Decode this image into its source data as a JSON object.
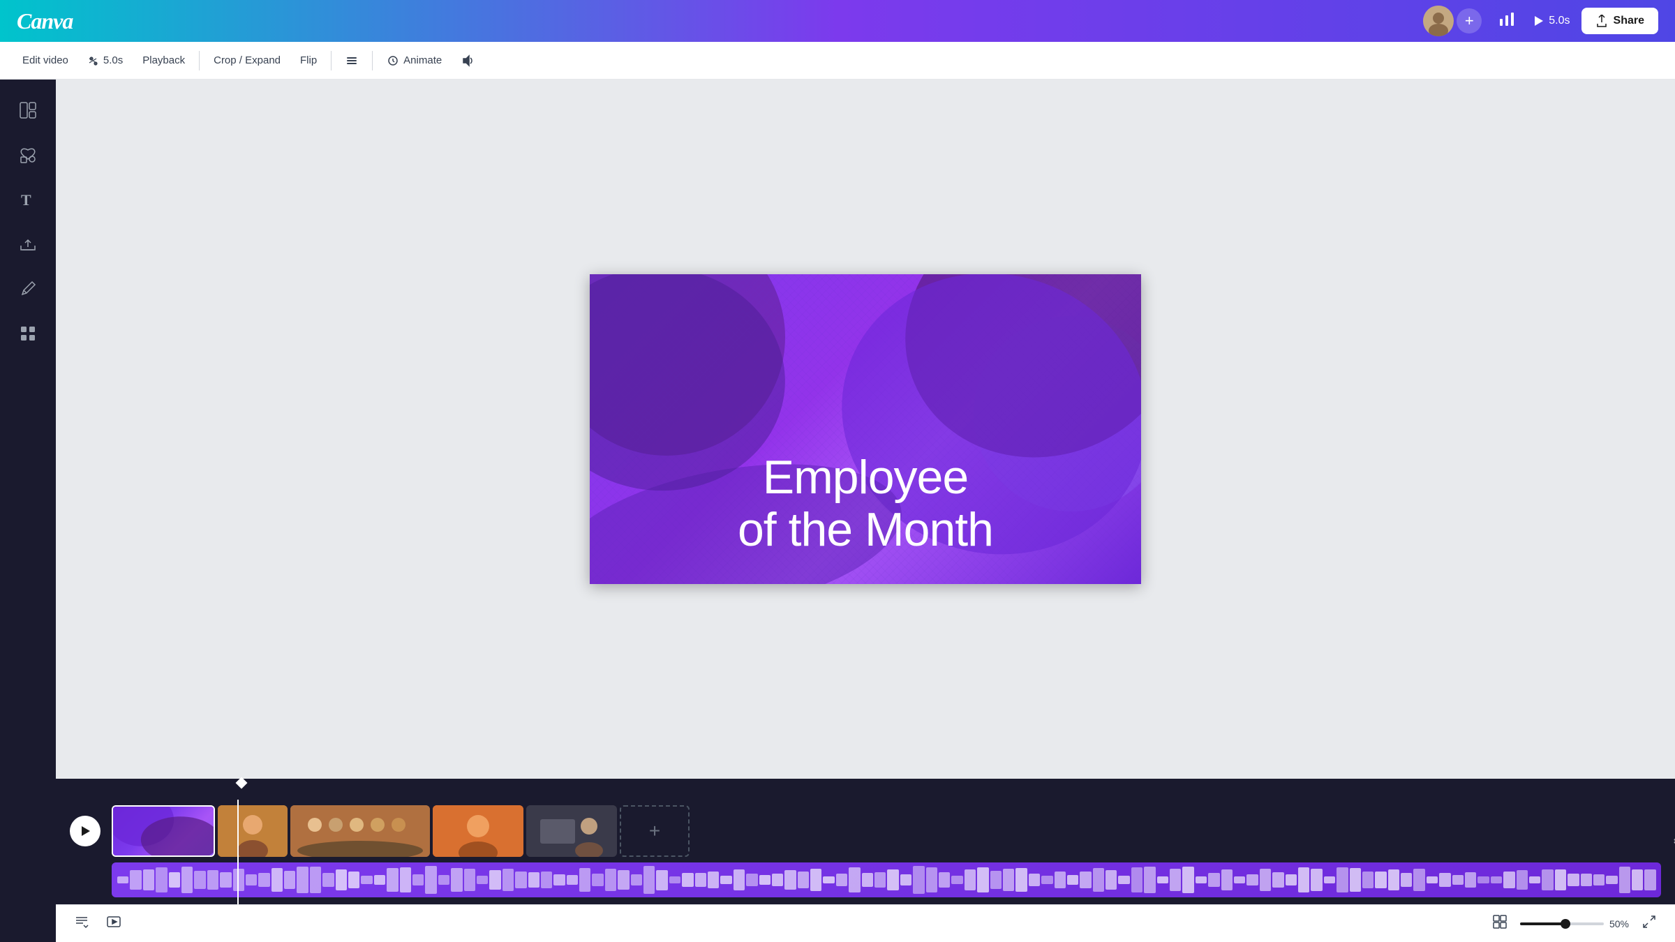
{
  "header": {
    "logo": "Canva",
    "plus_label": "+",
    "analytics_icon": "📊",
    "play_time": "5.0s",
    "share_label": "Share",
    "share_icon": "↑"
  },
  "toolbar": {
    "edit_video": "Edit video",
    "speed": "5.0s",
    "playback": "Playback",
    "crop_expand": "Crop / Expand",
    "flip": "Flip",
    "animate": "Animate",
    "volume_icon": "🔊"
  },
  "sidebar": {
    "items": [
      {
        "icon": "⊞",
        "label": ""
      },
      {
        "icon": "♡",
        "label": ""
      },
      {
        "icon": "T",
        "label": ""
      },
      {
        "icon": "↓",
        "label": ""
      },
      {
        "icon": "✏",
        "label": ""
      },
      {
        "icon": "⋯",
        "label": ""
      }
    ]
  },
  "canvas": {
    "text_line1": "Employee",
    "text_line2": "of the Month"
  },
  "timeline": {
    "play_icon": "▶",
    "add_clip_icon": "+",
    "clips": [
      {
        "id": 1,
        "type": "purple",
        "selected": true
      },
      {
        "id": 2,
        "type": "warm",
        "selected": false
      },
      {
        "id": 3,
        "type": "group",
        "selected": false
      },
      {
        "id": 4,
        "type": "orange",
        "selected": false
      },
      {
        "id": 5,
        "type": "dark",
        "selected": false
      }
    ]
  },
  "bottom_bar": {
    "notes_icon": "≡",
    "preview_icon": "▷",
    "grid_icon": "⊟",
    "zoom_percent": "50%",
    "expand_icon": "⤢"
  }
}
